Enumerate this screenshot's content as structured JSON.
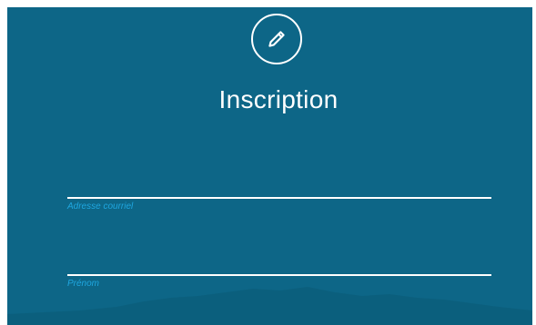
{
  "form": {
    "title": "Inscription",
    "header_icon": "pencil-icon",
    "fields": [
      {
        "label": "Adresse courriel",
        "value": ""
      },
      {
        "label": "Prénom",
        "value": ""
      }
    ]
  },
  "colors": {
    "background": "#0d6687",
    "label_accent": "#1fa7e0",
    "text": "#ffffff"
  }
}
